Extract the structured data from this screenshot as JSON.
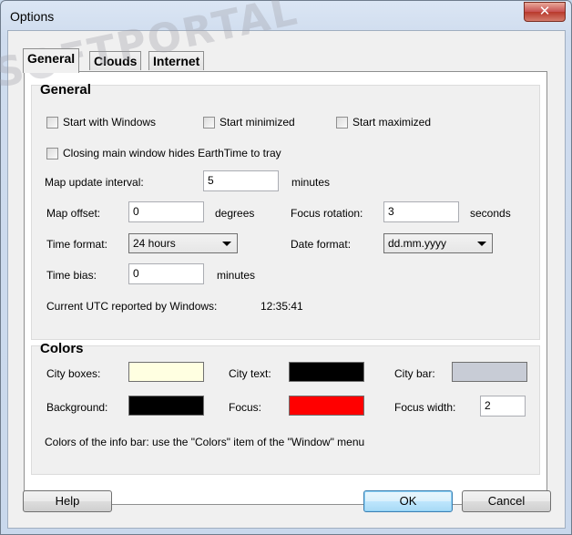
{
  "window": {
    "title": "Options",
    "close_glyph": "✕"
  },
  "tabs": [
    {
      "label": "General",
      "active": true
    },
    {
      "label": "Clouds",
      "active": false
    },
    {
      "label": "Internet",
      "active": false
    }
  ],
  "general": {
    "title": "General",
    "start_with_windows": "Start with Windows",
    "start_minimized": "Start minimized",
    "start_maximized": "Start maximized",
    "closing_hides": "Closing main window hides EarthTime to tray",
    "map_update_label": "Map update interval:",
    "map_update_value": "5",
    "map_update_unit": "minutes",
    "map_offset_label": "Map offset:",
    "map_offset_value": "0",
    "map_offset_unit": "degrees",
    "focus_rotation_label": "Focus rotation:",
    "focus_rotation_value": "3",
    "focus_rotation_unit": "seconds",
    "time_format_label": "Time format:",
    "time_format_value": "24 hours",
    "date_format_label": "Date format:",
    "date_format_value": "dd.mm.yyyy",
    "time_bias_label": "Time bias:",
    "time_bias_value": "0",
    "time_bias_unit": "minutes",
    "utc_label": "Current UTC reported by Windows:",
    "utc_value": "12:35:41"
  },
  "colors": {
    "title": "Colors",
    "city_boxes_label": "City boxes:",
    "city_boxes_color": "#ffffe1",
    "city_text_label": "City text:",
    "city_text_color": "#000000",
    "city_bar_label": "City bar:",
    "city_bar_color": "#c8ccd6",
    "background_label": "Background:",
    "background_color": "#000000",
    "focus_label": "Focus:",
    "focus_color": "#ff0000",
    "focus_width_label": "Focus width:",
    "focus_width_value": "2",
    "info_note": "Colors of the info bar: use the \"Colors\" item of the \"Window\" menu"
  },
  "buttons": {
    "help": "Help",
    "ok": "OK",
    "cancel": "Cancel"
  },
  "watermark": "SOFTPORTAL"
}
